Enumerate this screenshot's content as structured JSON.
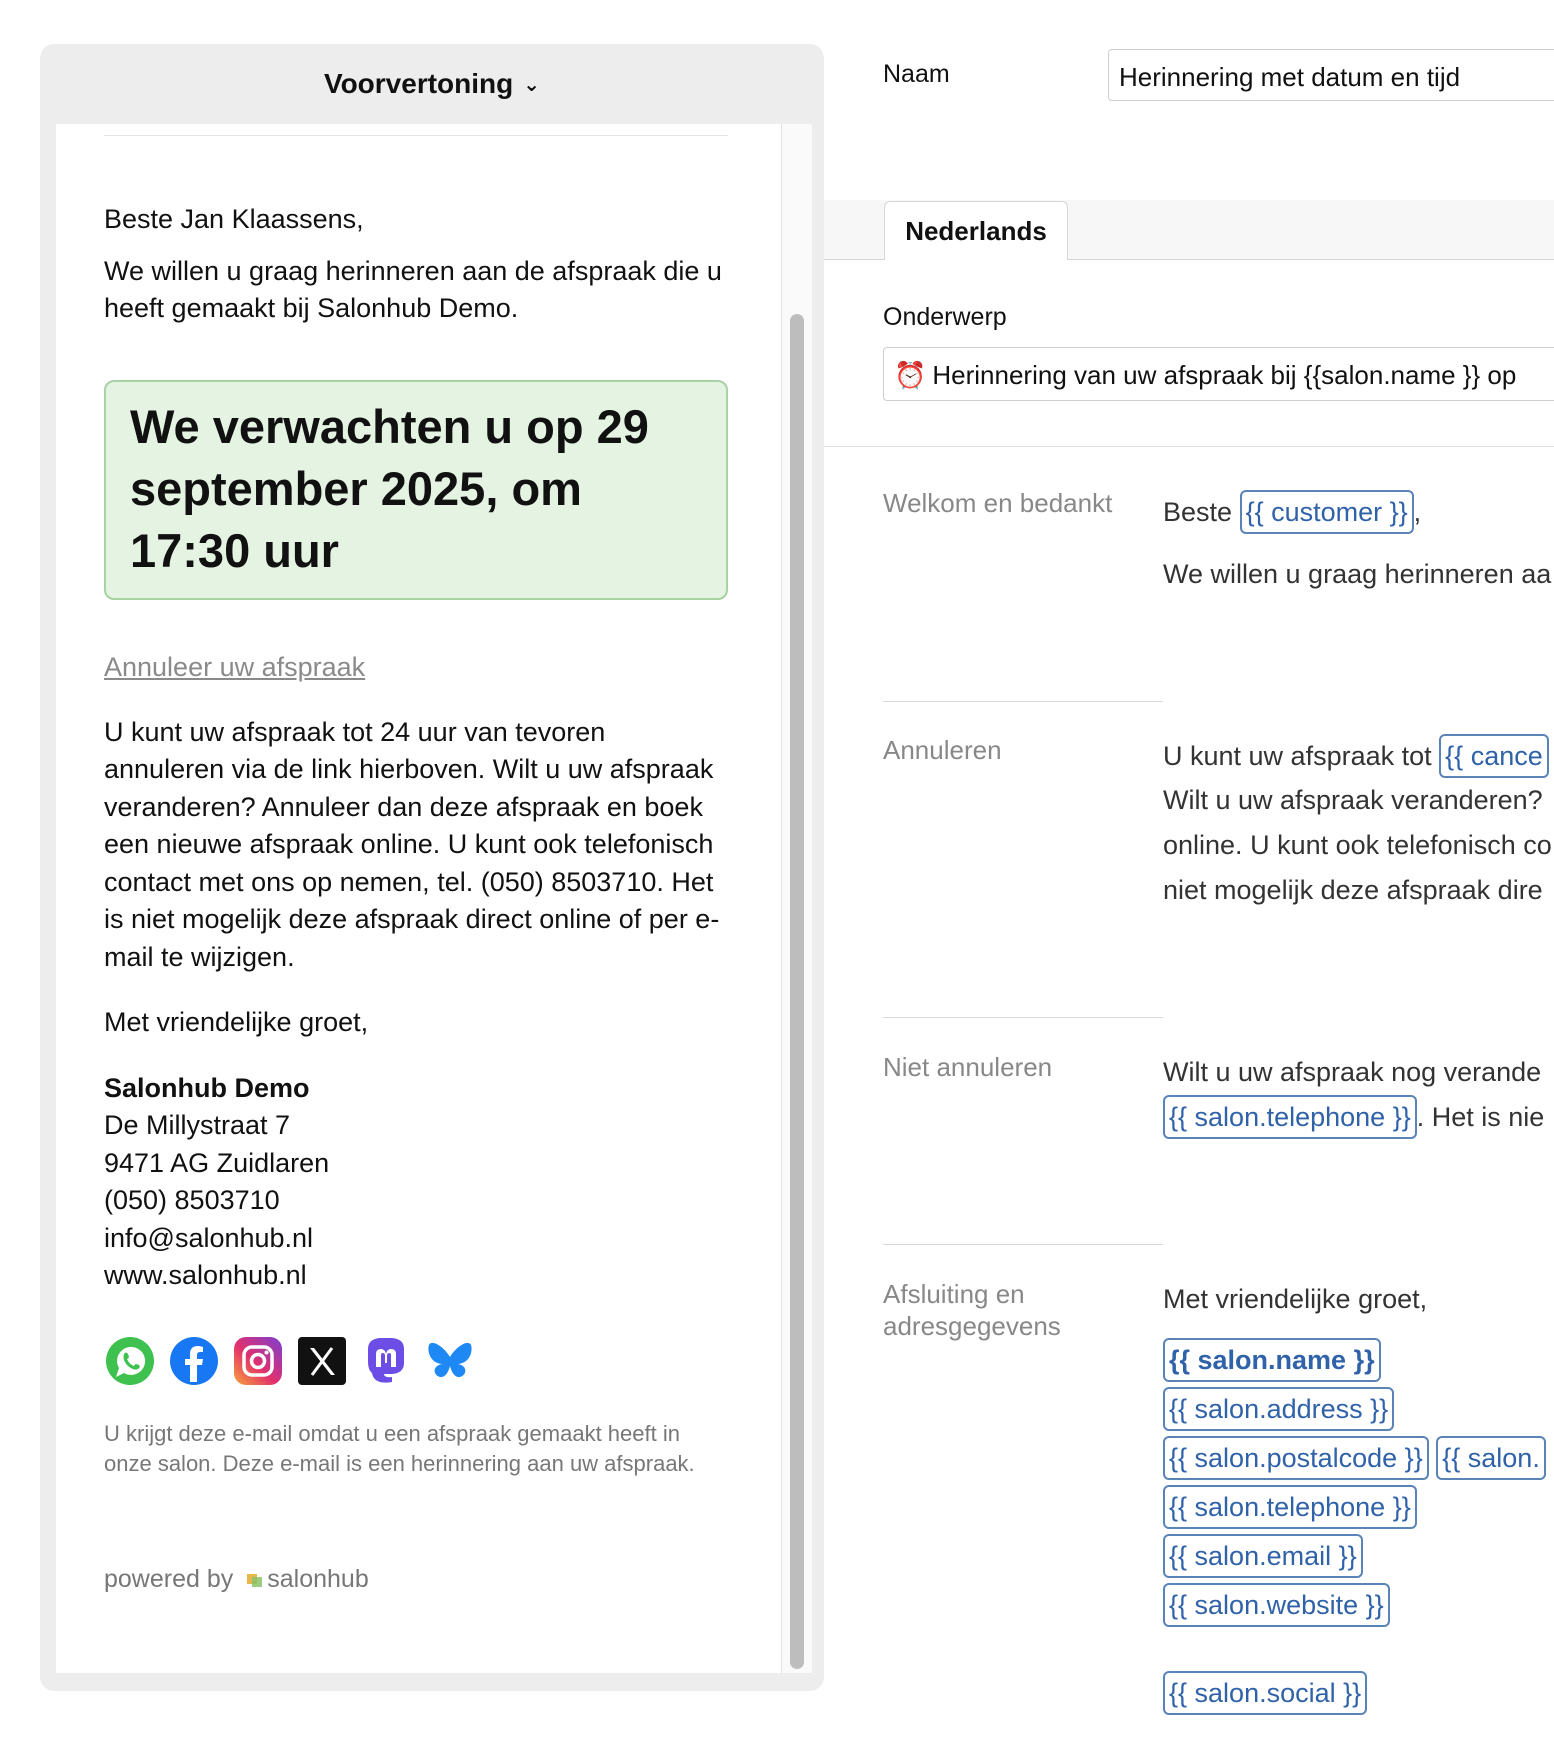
{
  "preview": {
    "header_title": "Voorvertoning",
    "greeting": "Beste Jan Klaassens,",
    "intro": "We willen u graag herinneren aan de afspraak die u heeft gemaakt bij Salonhub Demo.",
    "highlight": "We verwachten u op 29 september 2025, om 17:30 uur",
    "cancel_link": "Annuleer uw afspraak",
    "cancel_text": "U kunt uw afspraak tot 24 uur van tevoren annuleren via de link hierboven. Wilt u uw afspraak veranderen? Annuleer dan deze afspraak en boek een nieuwe afspraak online. U kunt ook telefonisch contact met ons op nemen, tel. (050) 8503710. Het is niet mogelijk deze afspraak direct online of per e-mail te wijzigen.",
    "regards": "Met vriendelijke groet,",
    "address": {
      "name": "Salonhub Demo",
      "street": "De Millystraat 7",
      "city": "9471 AG Zuidlaren",
      "phone": "(050) 8503710",
      "email": "info@salonhub.nl",
      "website": "www.salonhub.nl"
    },
    "social_icons": [
      "whatsapp-icon",
      "facebook-icon",
      "instagram-icon",
      "x-icon",
      "mastodon-icon",
      "bluesky-icon"
    ],
    "footer_note": "U krijgt deze e-mail omdat u een afspraak gemaakt heeft in onze salon. Deze e-mail is een herinnering aan uw afspraak.",
    "powered_by": "powered by",
    "brand": "salonhub"
  },
  "editor": {
    "naam_label": "Naam",
    "naam_value": "Herinnering met datum en tijd",
    "tab_label": "Nederlands",
    "onderwerp_label": "Onderwerp",
    "onderwerp_value": "Herinnering van uw afspraak bij  {{salon.name }}  op",
    "sections": {
      "welkom": {
        "label": "Welkom en bedankt",
        "beste": "Beste",
        "tag_customer": "{{ customer }}",
        "comma": ",",
        "line2": "We willen u graag herinneren aa"
      },
      "annuleren": {
        "label": "Annuleren",
        "line1_prefix": "U kunt uw afspraak tot",
        "tag_cancel": "{{ cance",
        "line2": "Wilt u uw afspraak veranderen?",
        "line3": "online. U kunt ook telefonisch co",
        "line4": "niet mogelijk deze afspraak dire"
      },
      "niet_annuleren": {
        "label": "Niet annuleren",
        "line1": "Wilt u uw afspraak nog verande",
        "tag_telephone": "{{ salon.telephone }}",
        "line2_suffix": ". Het is nie"
      },
      "afsluiting": {
        "label": "Afsluiting en adresgegevens",
        "regards": "Met vriendelijke groet,",
        "tag_name": "{{ salon.name }}",
        "tag_address": "{{ salon.address }}",
        "tag_postalcode": "{{ salon.postalcode }}",
        "tag_city_partial": "{{ salon.",
        "tag_telephone": "{{ salon.telephone }}",
        "tag_email": "{{ salon.email }}",
        "tag_website": "{{ salon.website }}",
        "tag_social": "{{ salon.social }}"
      }
    }
  },
  "colors": {
    "highlight_bg": "#e4f3e2",
    "highlight_border": "#a9d2a4",
    "tag_border": "#5a83b8",
    "tag_text": "#2f62a8"
  }
}
